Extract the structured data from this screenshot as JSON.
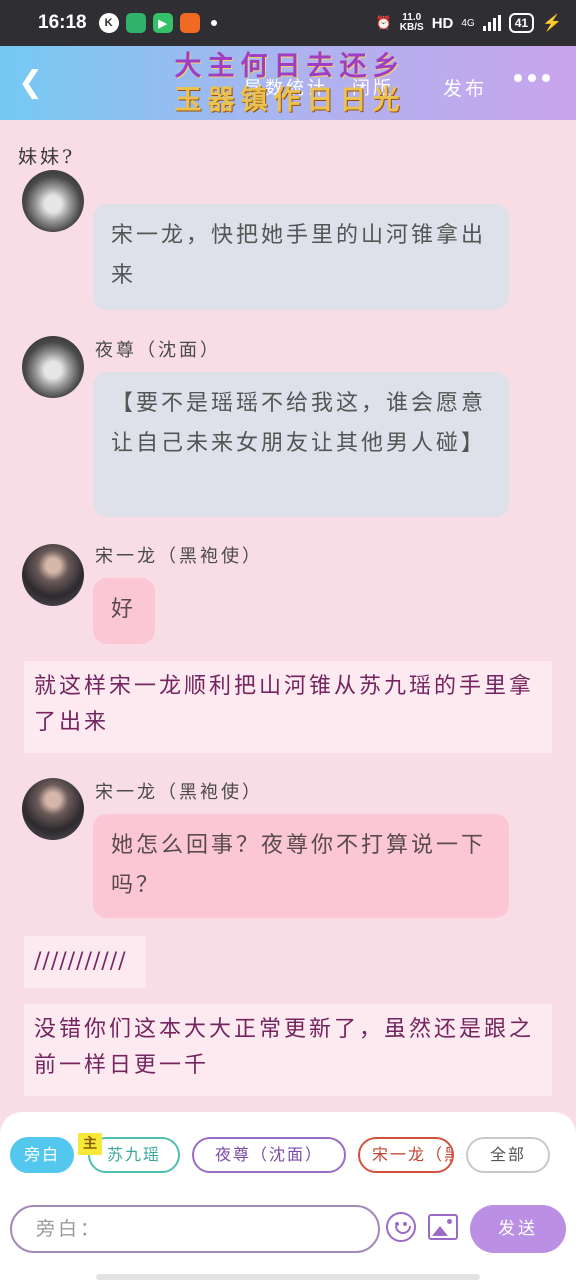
{
  "status_bar": {
    "time": "16:18",
    "speed": "11.0",
    "speed_unit": "KB/S",
    "hd": "HD",
    "network": "4G",
    "battery": "41"
  },
  "header": {
    "title_line1": "大主何日去还乡",
    "title_line2": "玉器镇作日日光",
    "tab1": "导数统计",
    "tab2": "闭版",
    "publish": "发布"
  },
  "chat": {
    "prev_text": "妹妹?",
    "messages": [
      {
        "name": "",
        "text": "宋一龙，快把她手里的山河锥拿出来"
      },
      {
        "name": "夜尊（沈面）",
        "text": "【要不是瑶瑶不给我这，谁会愿意让自己未来女朋友让其他男人碰】"
      },
      {
        "name": "宋一龙（黑袍使）",
        "text": "好"
      },
      {
        "name": "宋一龙（黑袍使）",
        "text": "她怎么回事？夜尊你不打算说一下吗？"
      }
    ],
    "narrations": [
      "就这样宋一龙顺利把山河锥从苏九瑶的手里拿了出来",
      "///////////",
      "没错你们这本大大正常更新了，虽然还是跟之前一样日更一千"
    ]
  },
  "composer": {
    "chips": [
      "旁白",
      "苏九瑶",
      "夜尊（沈面）",
      "宋一龙（黑袍使）",
      "全部"
    ],
    "mark": "主",
    "input_placeholder": "旁白：",
    "send_label": "发送"
  },
  "icons": {
    "back": "back-arrow-icon",
    "more": "more-icon",
    "emoji": "emoji-icon",
    "image": "image-icon"
  },
  "colors": {
    "header_gradient_start": "#74c9f3",
    "header_gradient_end": "#c8a4ec",
    "background": "#f9dde6",
    "grey_bubble": "#dee0ea",
    "pink_bubble": "#fbc7d5",
    "send_button": "#bb8fe3"
  }
}
